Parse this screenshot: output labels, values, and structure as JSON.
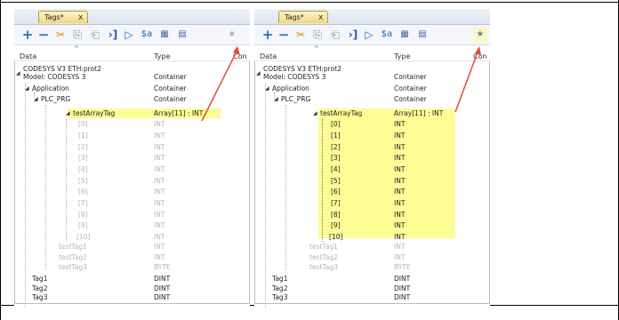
{
  "panels": [
    {
      "tab": {
        "label": "Tags*",
        "close": "x"
      },
      "toolbar": {
        "plus": "+",
        "minus": "−",
        "cut": "✂",
        "copy": "⎘",
        "paste": "⎗",
        "go": "›]",
        "play": "▷",
        "sort": "$a",
        "grid": "▦",
        "map": "▤",
        "pin": "∗"
      },
      "header": {
        "data": "Data",
        "type": "Type",
        "con": "Con",
        "sort_caret": "^"
      },
      "rows": [
        {
          "name": "CODESYS V3 ETH:prot2",
          "type": ""
        },
        {
          "name": "Model: CODESYS 3",
          "type": "Container"
        },
        {
          "name": "Application",
          "type": "Container"
        },
        {
          "name": "PLC_PRG",
          "type": "Container"
        },
        {
          "name": "testArrayTag",
          "type": "Array[11] : INT"
        },
        {
          "name": "[0]",
          "type": "INT"
        },
        {
          "name": "[1]",
          "type": "INT"
        },
        {
          "name": "[2]",
          "type": "INT"
        },
        {
          "name": "[3]",
          "type": "INT"
        },
        {
          "name": "[4]",
          "type": "INT"
        },
        {
          "name": "[5]",
          "type": "INT"
        },
        {
          "name": "[6]",
          "type": "INT"
        },
        {
          "name": "[7]",
          "type": "INT"
        },
        {
          "name": "[8]",
          "type": "INT"
        },
        {
          "name": "[9]",
          "type": "INT"
        },
        {
          "name": "[10]",
          "type": "INT"
        },
        {
          "name": "testTag1",
          "type": "INT"
        },
        {
          "name": "testTag2",
          "type": "INT"
        },
        {
          "name": "testTag3",
          "type": "BYTE"
        },
        {
          "name": "Tag1",
          "type": "DINT"
        },
        {
          "name": "Tag2",
          "type": "DINT"
        },
        {
          "name": "Tag3",
          "type": "DINT"
        }
      ]
    },
    {
      "tab": {
        "label": "Tags*",
        "close": "x"
      },
      "toolbar": {
        "plus": "+",
        "minus": "−",
        "cut": "✂",
        "copy": "⎘",
        "paste": "⎗",
        "go": "›]",
        "play": "▷",
        "sort": "$a",
        "grid": "▦",
        "map": "▤",
        "pin": "∗"
      },
      "header": {
        "data": "Data",
        "type": "Type",
        "con": "Con",
        "sort_caret": "^"
      },
      "rows": [
        {
          "name": "CODESYS V3 ETH:prot2",
          "type": ""
        },
        {
          "name": "Model: CODESYS 3",
          "type": "Container"
        },
        {
          "name": "Application",
          "type": "Container"
        },
        {
          "name": "PLC_PRG",
          "type": "Container"
        },
        {
          "name": "testArrayTag",
          "type": "Array[11] : INT"
        },
        {
          "name": "[0]",
          "type": "INT"
        },
        {
          "name": "[1]",
          "type": "INT"
        },
        {
          "name": "[2]",
          "type": "INT"
        },
        {
          "name": "[3]",
          "type": "INT"
        },
        {
          "name": "[4]",
          "type": "INT"
        },
        {
          "name": "[5]",
          "type": "INT"
        },
        {
          "name": "[6]",
          "type": "INT"
        },
        {
          "name": "[7]",
          "type": "INT"
        },
        {
          "name": "[8]",
          "type": "INT"
        },
        {
          "name": "[9]",
          "type": "INT"
        },
        {
          "name": "[10]",
          "type": "INT"
        },
        {
          "name": "testTag1",
          "type": "INT"
        },
        {
          "name": "testTag2",
          "type": "INT"
        },
        {
          "name": "testTag3",
          "type": "BYTE"
        },
        {
          "name": "Tag1",
          "type": "DINT"
        },
        {
          "name": "Tag2",
          "type": "DINT"
        },
        {
          "name": "Tag3",
          "type": "DINT"
        }
      ]
    }
  ],
  "colors": {
    "highlight": "#fefc95",
    "arrow": "#e04b3a",
    "accent": "#1a73c9"
  }
}
